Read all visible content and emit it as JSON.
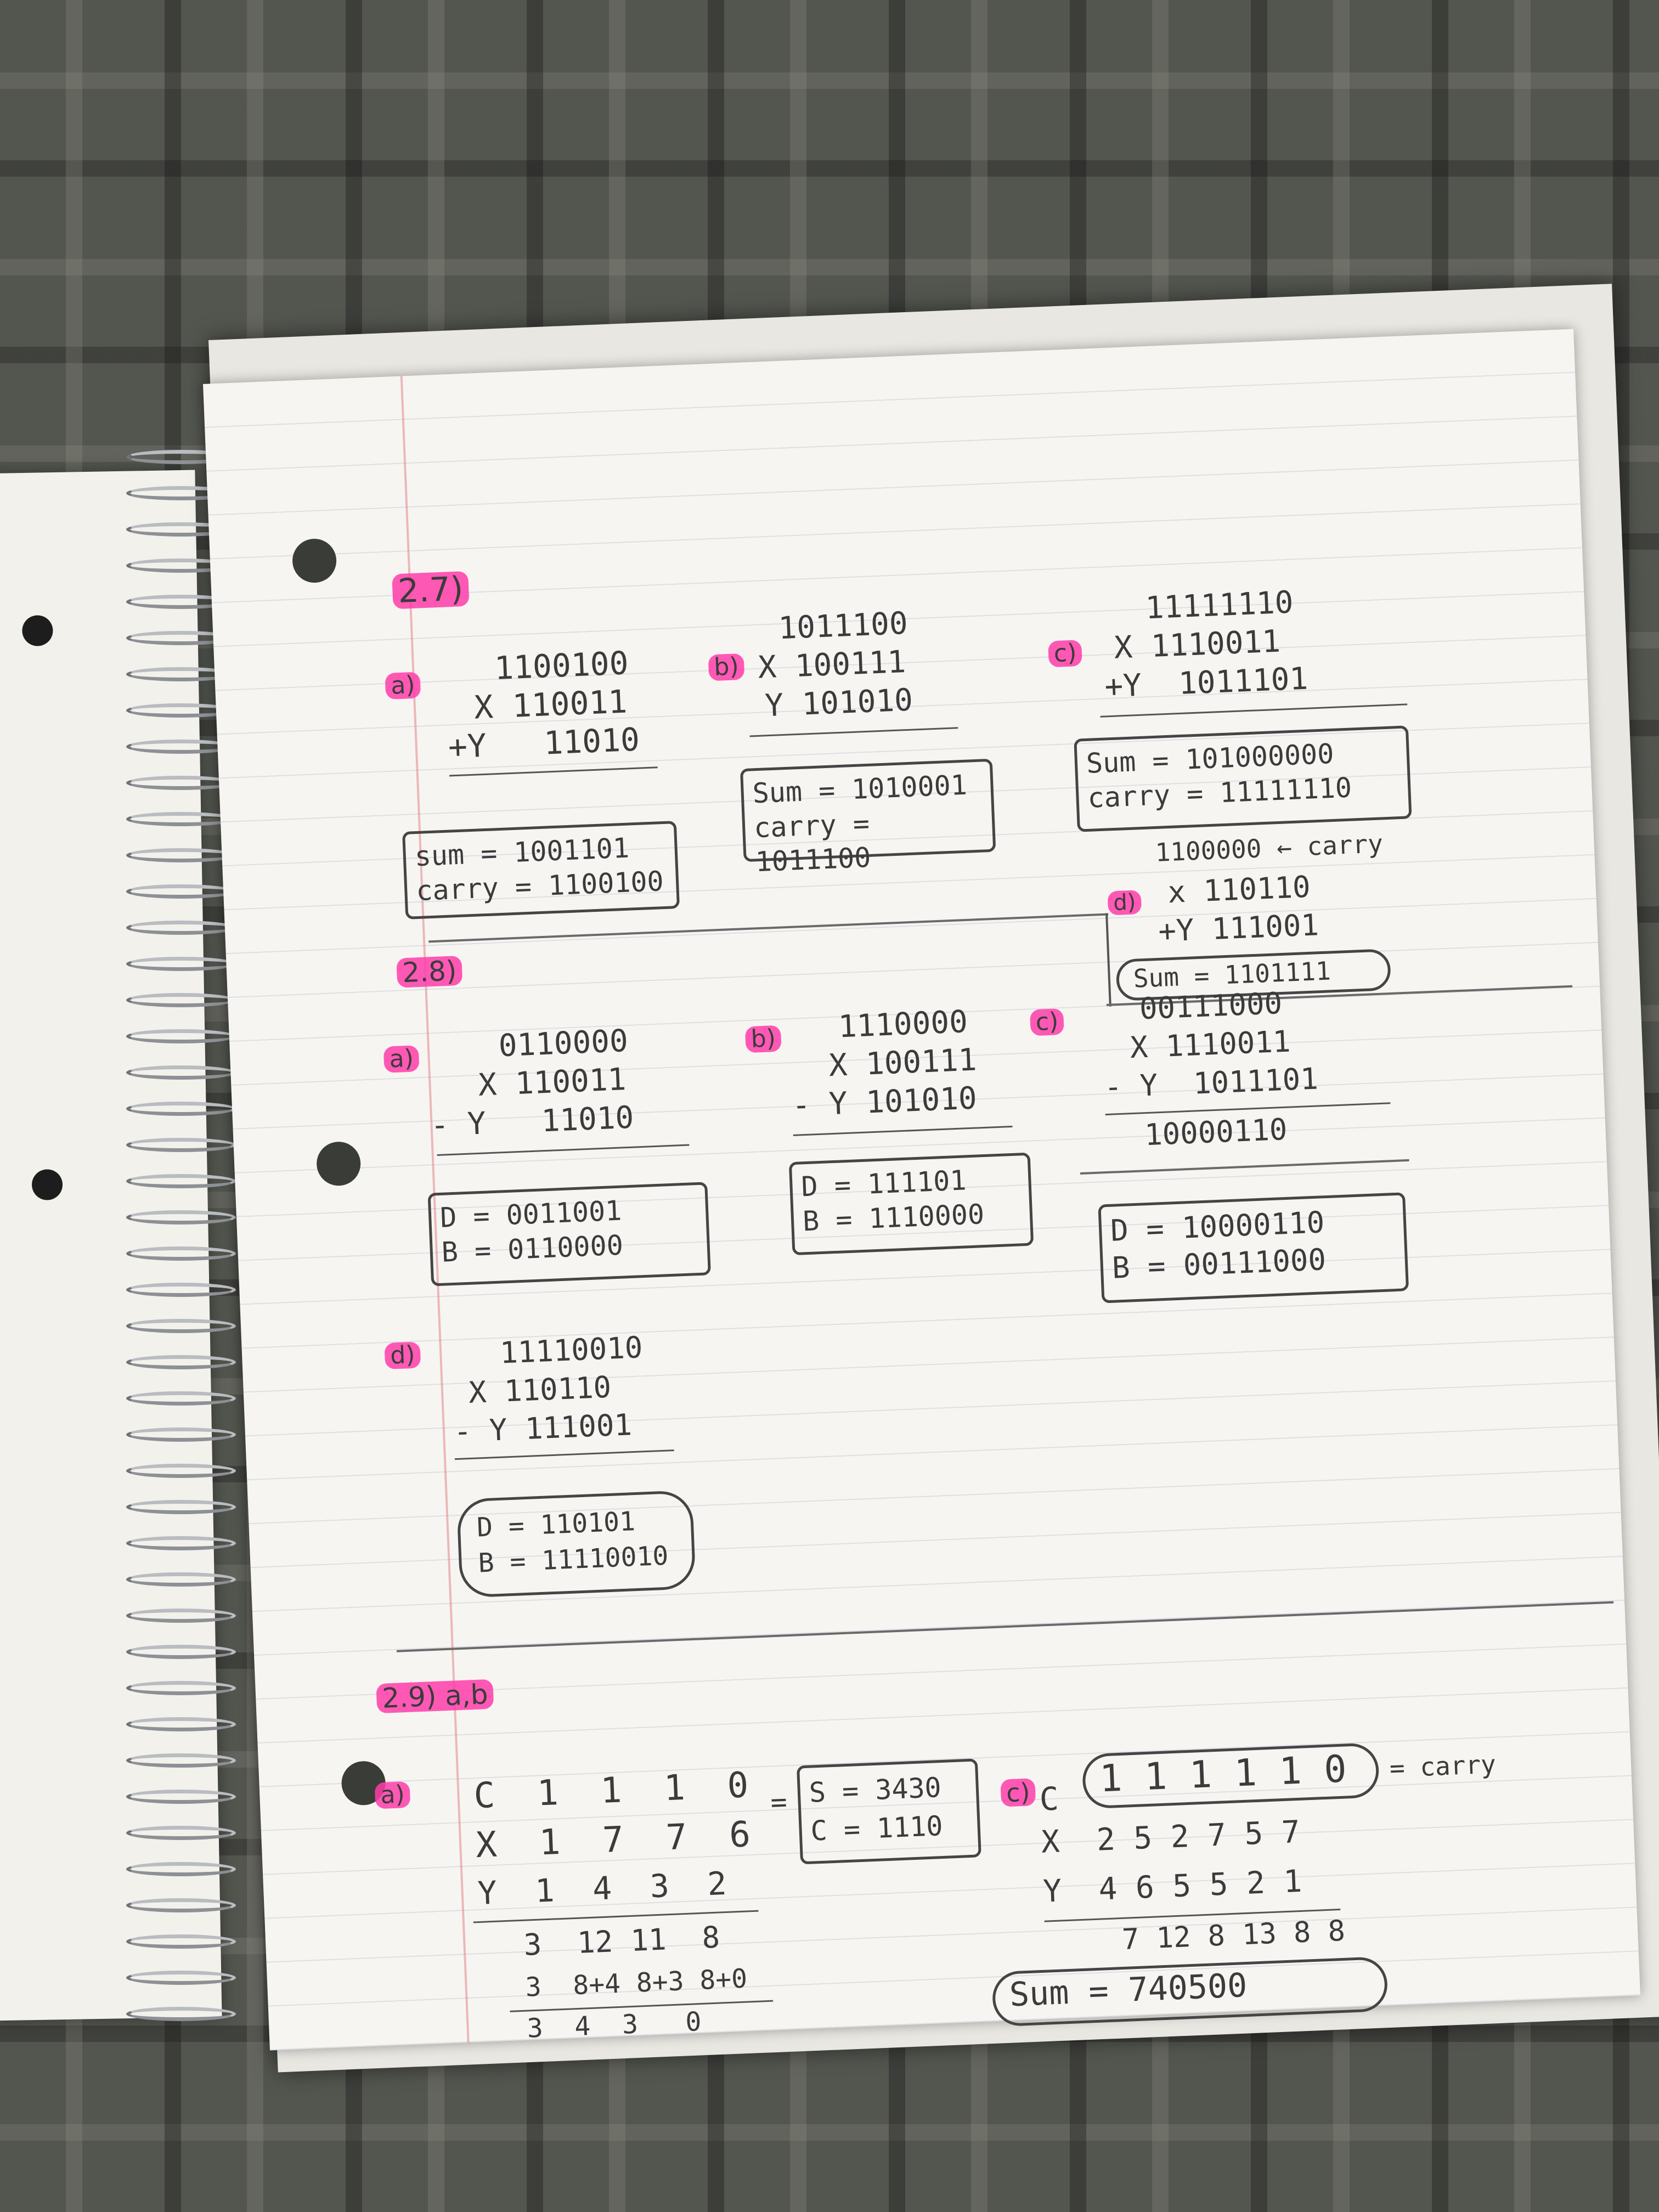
{
  "p27": {
    "label": "2.7)",
    "a": {
      "tag": "a)",
      "top": "1100100",
      "x": "X 110011",
      "y": "+Y   11010",
      "sum": "sum = 1001101",
      "carry": "carry = 1100100"
    },
    "b": {
      "tag": "b)",
      "top": "1011100",
      "x": "X 100111",
      "y": "Y 101010",
      "sum": "Sum = 1010001",
      "carry": "carry = 1011100"
    },
    "c": {
      "tag": "c)",
      "top": "11111110",
      "x": "X 1110011",
      "y": "+Y  1011101",
      "sum": "Sum = 101000000",
      "carry": "carry = 11111110"
    },
    "d": {
      "tag": "d)",
      "top": "1100000 ← carry",
      "x": "x 110110",
      "y": "+Y 111001",
      "sum": "Sum = 1101111"
    }
  },
  "p28": {
    "label": "2.8)",
    "a": {
      "tag": "a)",
      "top": "0110000",
      "x": "X 110011",
      "y": "- Y   11010",
      "d": "D = 0011001",
      "b": "B = 0110000"
    },
    "b": {
      "tag": "b)",
      "top": "1110000",
      "x": "X 100111",
      "y": "- Y 101010",
      "d": "D = 111101",
      "b": "B = 1110000"
    },
    "c": {
      "tag": "c)",
      "top": "00111000",
      "x": "X 1110011",
      "y": "- Y  1011101",
      "result": "10000110",
      "d": "D = 10000110",
      "b": "B = 00111000"
    },
    "d": {
      "tag": "d)",
      "top": "11110010",
      "x": "X 110110",
      "y": "- Y 111001",
      "d": "D = 110101",
      "b": "B = 11110010"
    }
  },
  "p29": {
    "label": "2.9) a,b",
    "a": {
      "tag": "a)",
      "c_row": "C  1  1  1  0",
      "x_row": "X  1  7  7  6",
      "y_row": "Y  1  4  3  2",
      "r1": "3  12 11  8",
      "r2": "3  8+4 8+3 8+0",
      "r3": "3  4  3   0",
      "eq": "=",
      "s": "S = 3430",
      "c": "C = 1110"
    },
    "c": {
      "tag": "c)",
      "c_label": "C",
      "carry": "1 1 1 1 1 0",
      "carry_note": "= carry",
      "x_row": "X  2 5 2 7 5 7",
      "y_row": "Y  4 6 5 5 2 1",
      "partial": "7 12 8 13 8 8",
      "sum": "Sum = 740500"
    }
  }
}
